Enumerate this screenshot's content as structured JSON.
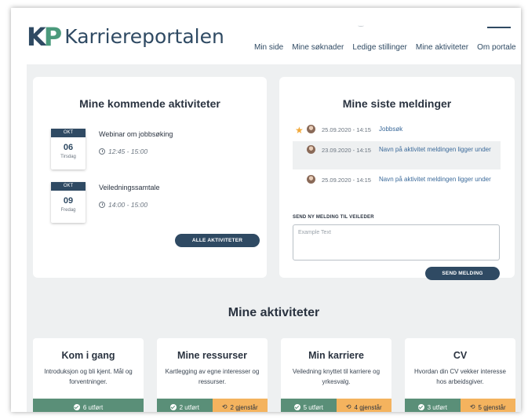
{
  "app": {
    "logo_mark_k": "K",
    "logo_mark_p": "P",
    "logo_text": "Karriereportalen"
  },
  "nav": [
    "Min side",
    "Mine søknader",
    "Ledige stillinger",
    "Mine aktiviteter",
    "Om portale"
  ],
  "upcoming": {
    "title": "Mine kommende aktiviteter",
    "items": [
      {
        "month": "OKT",
        "day": "06",
        "weekday": "Tirsdag",
        "title": "Webinar om jobbsøking",
        "time": "12:45 - 15:00"
      },
      {
        "month": "OKT",
        "day": "09",
        "weekday": "Fredag",
        "title": "Veiledningssamtale",
        "time": "14:00 - 15:00"
      }
    ],
    "button": "ALLE AKTIVITETER"
  },
  "messages": {
    "title": "Mine siste meldinger",
    "items": [
      {
        "date": "25.09.2020 - 14:15",
        "text": "Jobbsøk",
        "starred": true
      },
      {
        "date": "23.09.2020 - 14:15",
        "text": "Navn på aktivitet meldingen ligger under",
        "starred": false
      },
      {
        "date": "25.09.2020 - 14:15",
        "text": "Navn på aktivitet meldingen ligger under",
        "starred": false
      }
    ],
    "send_label": "SEND NY MELDING TIL VEILEDER",
    "placeholder": "Example Text",
    "send_button": "SEND MELDING"
  },
  "activities": {
    "title": "Mine aktiviteter",
    "cards": [
      {
        "title": "Kom i gang",
        "desc": "Introduksjon og bli kjent. Mål og forventninger.",
        "done": "6 utført",
        "left": ""
      },
      {
        "title": "Mine ressurser",
        "desc": "Kartlegging av egne interesser og ressurser.",
        "done": "2 utført",
        "left": "2 gjenstår"
      },
      {
        "title": "Min karriere",
        "desc": "Veiledning knyttet til karriere og yrkesvalg.",
        "done": "5 utført",
        "left": "4 gjenstår"
      },
      {
        "title": "CV",
        "desc": "Hvordan din CV vekker interesse hos arbeidsgiver.",
        "done": "3 utført",
        "left": "5 gjenstår"
      }
    ]
  },
  "colors": {
    "navy": "#2f4a63",
    "green": "#5a8f78",
    "orange": "#f4b35e",
    "link": "#3b6a9a",
    "star": "#f2a93b"
  },
  "icons": {
    "clock": "clock-icon",
    "star": "star-icon",
    "check": "check-circle-icon",
    "cycle": "refresh-icon"
  }
}
